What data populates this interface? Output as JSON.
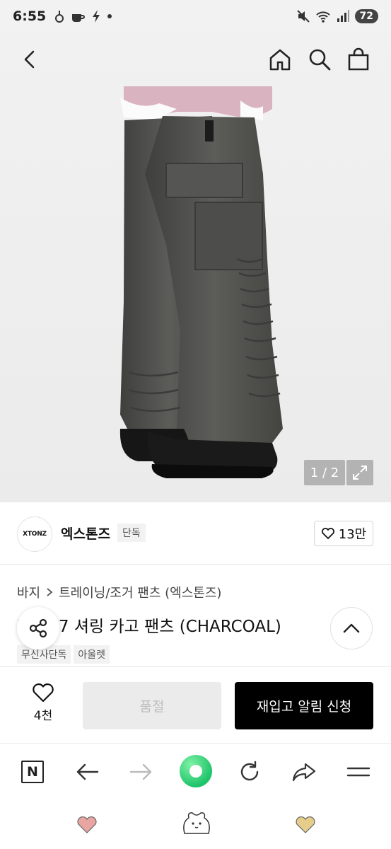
{
  "status": {
    "time": "6:55",
    "battery": "72"
  },
  "nav": {
    "back_icon": "chevron-left-icon",
    "home_icon": "home-icon",
    "search_icon": "search-icon",
    "cart_icon": "shopping-bag-icon"
  },
  "gallery": {
    "counter": "1 / 2"
  },
  "brand": {
    "logo_text": "XTONZ",
    "name": "엑스톤즈",
    "tag": "단독",
    "likes": "13만"
  },
  "product": {
    "breadcrumb_root": "바지",
    "breadcrumb_sub": "트레이닝/조거 팬츠 (엑스톤즈)",
    "title": "XP027 셔링 카고 팬츠 (CHARCOAL)",
    "tags": [
      "무신사단독",
      "아울렛"
    ]
  },
  "purchase": {
    "wish_count": "4천",
    "soldout_label": "품절",
    "restock_label": "재입고 알림 신청"
  },
  "colors": {
    "accent_green": "#1fc46a",
    "soldout_bg": "#ebebeb",
    "cta_bg": "#000000"
  }
}
